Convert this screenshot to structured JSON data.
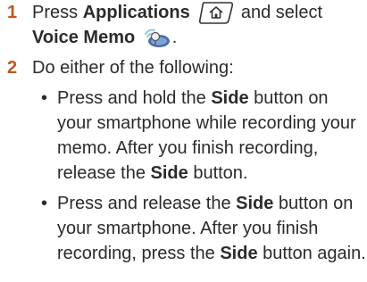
{
  "steps": [
    {
      "number": "1",
      "text_a": "Press ",
      "kw_a": "Applications",
      "text_b": " and select",
      "kw_b": "Voice Memo",
      "text_c": ".",
      "icons": [
        "applications-key-icon",
        "voice-memo-app-icon"
      ]
    },
    {
      "number": "2",
      "intro": "Do either of the following:",
      "bullets": [
        {
          "text_a": "Press and hold the ",
          "kw_a": "Side",
          "text_b": " button on your smartphone while recording your memo. After you finish recording, release the ",
          "kw_b": "Side",
          "text_c": " button."
        },
        {
          "text_a": "Press and release the ",
          "kw_a": "Side",
          "text_b": " button on your smartphone. After you finish recording, press the ",
          "kw_b": "Side",
          "text_c": " button again."
        }
      ]
    }
  ],
  "colors": {
    "step_number": "#c2571a",
    "body_text": "#2b2b2b"
  }
}
